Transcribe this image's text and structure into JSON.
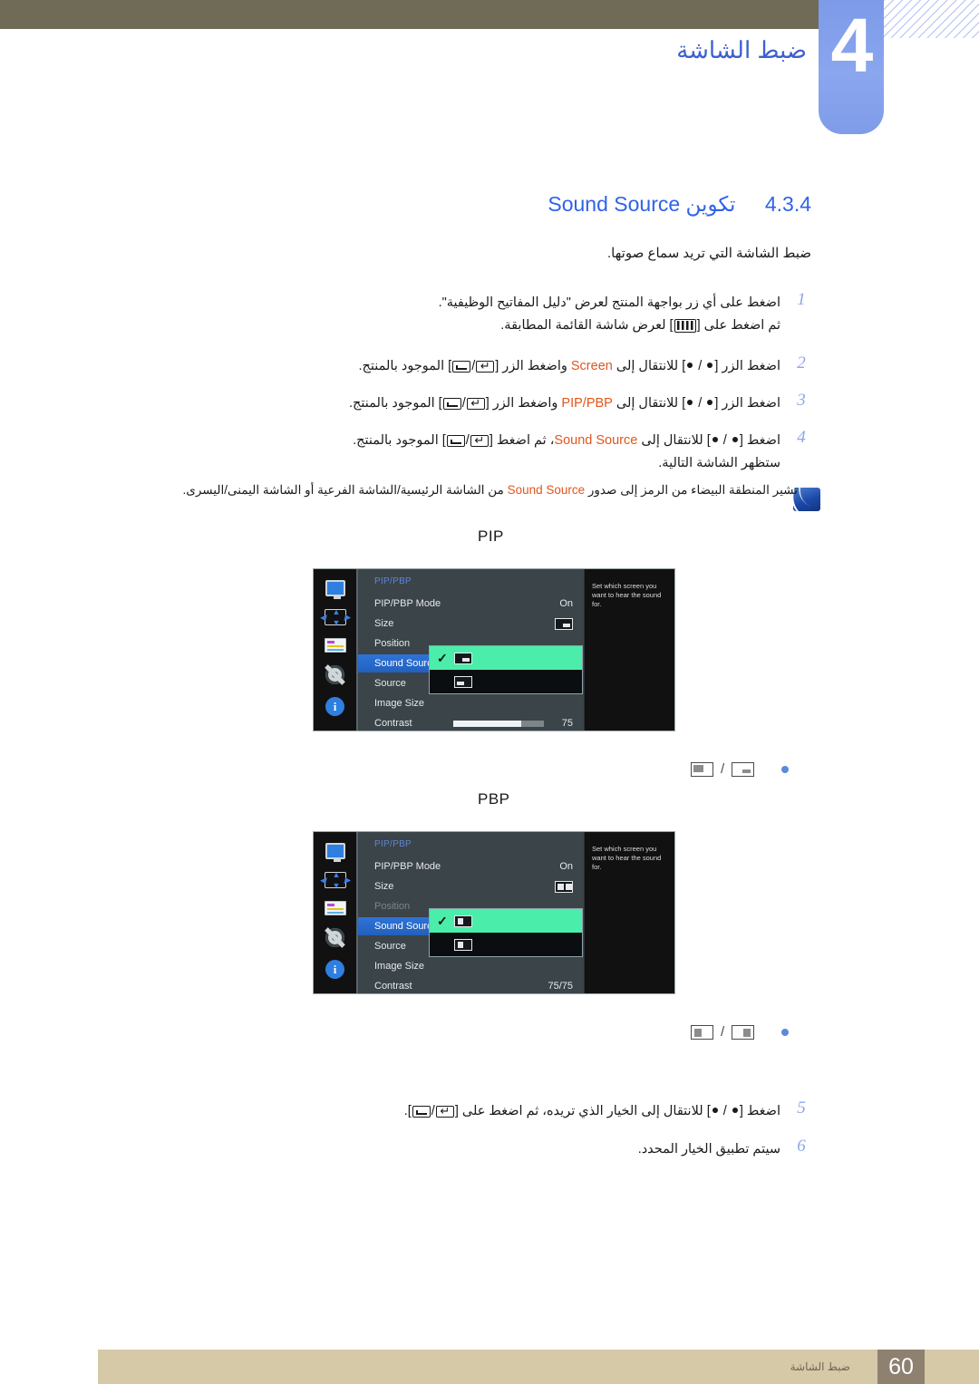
{
  "header": {
    "chapter_number": "4",
    "chapter_title": "ضبط الشاشة"
  },
  "section": {
    "number": "4.3.4",
    "title_ar": "تكوين",
    "title_en": "Sound Source",
    "description": "ضبط الشاشة التي تريد سماع صوتها."
  },
  "steps": [
    {
      "num": "1",
      "line1_a": "اضغط على أي زر بواجهة المنتج لعرض \"دليل المفاتيح الوظيفية\".",
      "line2_a": "ثم اضغط على [",
      "line2_b": "] لعرض شاشة القائمة المطابقة."
    },
    {
      "num": "2",
      "a": "اضغط الزر [",
      "b": " / ",
      "c": "] للانتقال إلى ",
      "en": "Screen",
      "d": " واضغط الزر [",
      "e": "/",
      "f": "] الموجود بالمنتج."
    },
    {
      "num": "3",
      "a": "اضغط الزر [",
      "b": " / ",
      "c": "] للانتقال إلى ",
      "en": "PIP/PBP",
      "d": " واضغط الزر [",
      "e": "/",
      "f": "] الموجود بالمنتج."
    },
    {
      "num": "4",
      "a": "اضغط [",
      "b": " / ",
      "c": "] للانتقال إلى ",
      "en": "Sound Source",
      "d": "، ثم اضغط [",
      "e": "/",
      "f": "] الموجود بالمنتج.",
      "line2": "ستظهر الشاشة التالية."
    },
    {
      "num": "5",
      "a": "اضغط [",
      "b": " / ",
      "c": "] للانتقال إلى الخيار الذي تريده، ثم اضغط على [",
      "e": "/",
      "f": "]."
    },
    {
      "num": "6",
      "a": "سيتم تطبيق الخيار المحدد."
    }
  ],
  "note": {
    "text_a": "تشير المنطقة البيضاء من الرمز إلى صدور ",
    "text_en": "Sound Source",
    "text_b": " من الشاشة الرئيسية/الشاشة الفرعية أو الشاشة اليمنى/اليسرى."
  },
  "figures": [
    {
      "label": "PIP",
      "osd": {
        "menu_header": "PIP/PBP",
        "help_text": "Set which screen you want to hear the sound for.",
        "rows": [
          {
            "label": "PIP/PBP Mode",
            "value": "On",
            "type": "text"
          },
          {
            "label": "Size",
            "value": "",
            "type": "glyph-pip"
          },
          {
            "label": "Position",
            "value": "",
            "type": "none"
          },
          {
            "label": "Sound Source",
            "value": "",
            "type": "selected"
          },
          {
            "label": "Source",
            "value": "",
            "type": "none"
          },
          {
            "label": "Image Size",
            "value": "",
            "type": "none"
          },
          {
            "label": "Contrast",
            "value": "75",
            "type": "slider"
          }
        ],
        "options": [
          {
            "glyph": "pip-main",
            "checked": true
          },
          {
            "glyph": "pip-sub",
            "checked": false
          }
        ],
        "rail_icons": [
          "monitor-icon",
          "position-icon",
          "osd-icon",
          "gear-icon",
          "info-icon"
        ]
      },
      "legend": {
        "left": "pip-sub-box",
        "right": "pip-main-box",
        "separator": "/"
      }
    },
    {
      "label": "PBP",
      "osd": {
        "menu_header": "PIP/PBP",
        "help_text": "Set which screen you want to hear the sound for.",
        "rows": [
          {
            "label": "PIP/PBP Mode",
            "value": "On",
            "type": "text"
          },
          {
            "label": "Size",
            "value": "",
            "type": "glyph-pbp-size"
          },
          {
            "label": "Position",
            "value": "",
            "type": "dim"
          },
          {
            "label": "Sound Source",
            "value": "",
            "type": "selected"
          },
          {
            "label": "Source",
            "value": "",
            "type": "none"
          },
          {
            "label": "Image Size",
            "value": "",
            "type": "none"
          },
          {
            "label": "Contrast",
            "value": "75/75",
            "type": "text"
          }
        ],
        "options": [
          {
            "glyph": "pbp-left",
            "checked": true
          },
          {
            "glyph": "pbp-right",
            "checked": false
          }
        ],
        "rail_icons": [
          "monitor-icon",
          "position-icon",
          "osd-icon",
          "gear-icon",
          "info-icon"
        ]
      },
      "legend": {
        "left": "pbp-left-box",
        "right": "pbp-right-box",
        "separator": "/"
      }
    }
  ],
  "footer": {
    "text": "ضبط الشاشة",
    "page": "60"
  },
  "colors": {
    "header_band": "#6f6b57",
    "chapter_blue": "#7d9ae8",
    "title_blue": "#3c5fd0",
    "section_blue": "#2f63e8",
    "orange": "#e2551b",
    "step_num": "#8ea6e8",
    "footer_band": "#d6c9a8",
    "footer_page_box": "#8e8170",
    "osd_selected": "#2e74d8",
    "osd_option_on": "#4bedaa"
  }
}
